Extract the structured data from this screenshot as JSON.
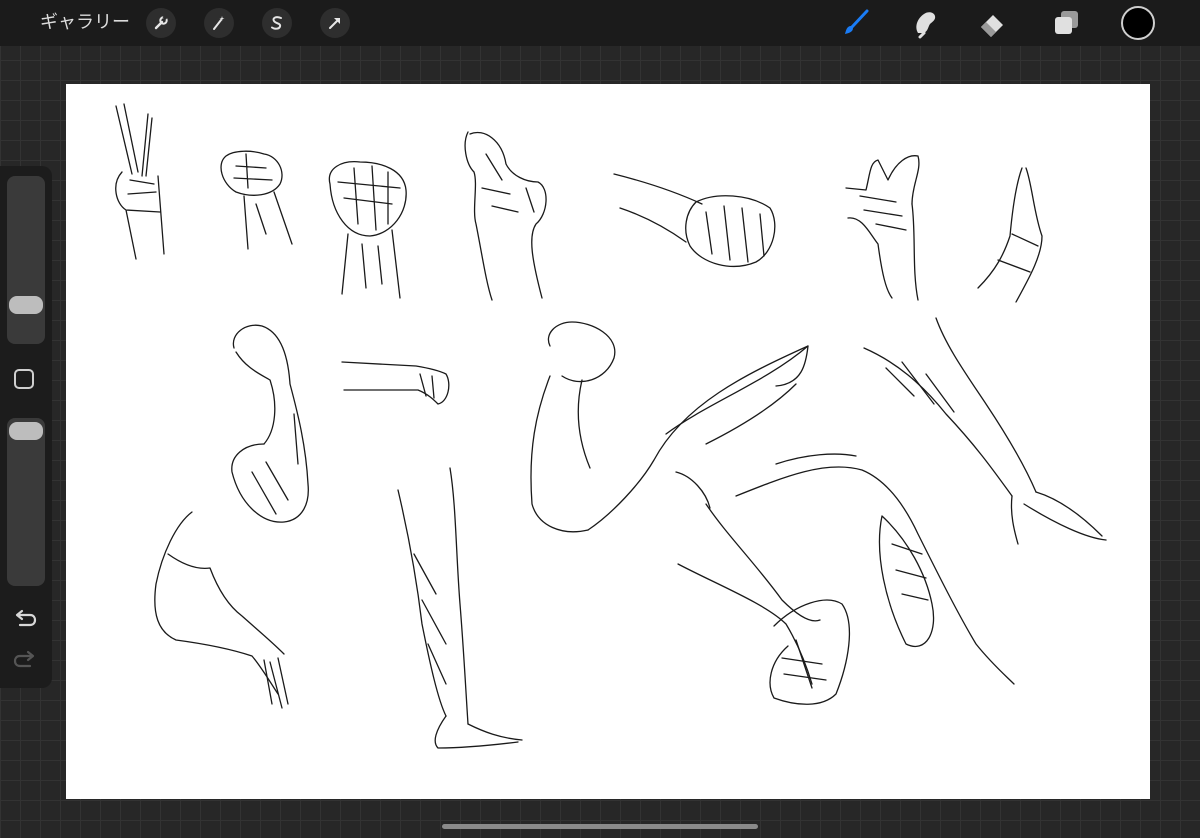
{
  "toolbar": {
    "gallery_label": "ギャラリー",
    "left_tools": [
      {
        "name": "actions",
        "icon": "wrench-icon"
      },
      {
        "name": "adjustments",
        "icon": "magic-wand-icon"
      },
      {
        "name": "selection",
        "icon": "selection-s-icon"
      },
      {
        "name": "transform",
        "icon": "arrow-cursor-icon"
      }
    ],
    "right_tools": [
      {
        "name": "brush",
        "icon": "brush-icon",
        "active": true
      },
      {
        "name": "smudge",
        "icon": "smudge-icon"
      },
      {
        "name": "eraser",
        "icon": "eraser-icon"
      },
      {
        "name": "layers",
        "icon": "layers-icon"
      }
    ],
    "current_color": "#000000",
    "active_color": "#1a7cf5"
  },
  "sidebar": {
    "brush_size_level": 0.7,
    "opacity_level": 0.05,
    "undo_icon": "undo-arrow-icon",
    "redo_icon": "redo-arrow-icon"
  },
  "canvas": {
    "content": "sketch-of-hands-arms-and-legs",
    "background": "#ffffff"
  }
}
